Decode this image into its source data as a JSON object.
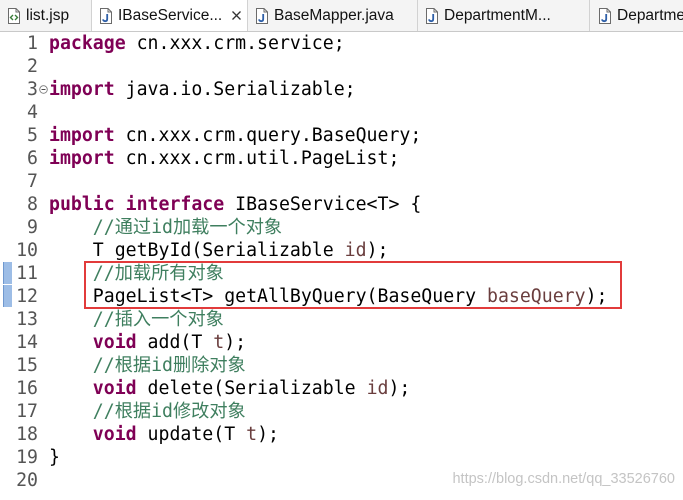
{
  "tabs": [
    {
      "label": "list.jsp",
      "icon": "jsp-file-icon"
    },
    {
      "label": "IBaseService...",
      "icon": "java-file-icon",
      "close_icon": "close-icon"
    },
    {
      "label": "BaseMapper.java",
      "icon": "java-file-icon"
    },
    {
      "label": "DepartmentM...",
      "icon": "java-file-icon"
    },
    {
      "label": "Departme",
      "icon": "java-file-icon"
    }
  ],
  "active_tab": 1,
  "editor": {
    "colors": {
      "keyword": "#7f0055",
      "comment": "#3f7f5f",
      "parameter": "#6a3e3e",
      "text": "#000000",
      "line_number": "#555555",
      "change_marker": "#9dbde6"
    },
    "fold_icon": "fold-collapse-icon",
    "change_markers": [
      11,
      12
    ],
    "highlight_box": {
      "color": "#e23b3b",
      "from_line": 11,
      "to_line": 12
    },
    "lines": [
      {
        "n": "1",
        "tokens": [
          "package",
          " cn.xxx.crm.service;"
        ]
      },
      {
        "n": "2",
        "tokens": []
      },
      {
        "n": "3",
        "tokens": [
          "import",
          " java.io.Serializable;"
        ]
      },
      {
        "n": "4",
        "tokens": []
      },
      {
        "n": "5",
        "tokens": [
          "import",
          " cn.xxx.crm.query.BaseQuery;"
        ]
      },
      {
        "n": "6",
        "tokens": [
          "import",
          " cn.xxx.crm.util.PageList;"
        ]
      },
      {
        "n": "7",
        "tokens": []
      },
      {
        "n": "8",
        "tokens": [
          "public",
          " interface",
          " IBaseService<T> {"
        ]
      },
      {
        "n": "9",
        "tokens": [
          "//通过id加载一个对象"
        ]
      },
      {
        "n": "10",
        "tokens": [
          "T getById(Serializable ",
          "id",
          ");"
        ]
      },
      {
        "n": "11",
        "tokens": [
          "//加载所有对象"
        ]
      },
      {
        "n": "12",
        "tokens": [
          "PageList<T> getAllByQuery(BaseQuery ",
          "baseQuery",
          ");"
        ]
      },
      {
        "n": "13",
        "tokens": [
          "//插入一个对象"
        ]
      },
      {
        "n": "14",
        "tokens": [
          "void",
          " add(T ",
          "t",
          ");"
        ]
      },
      {
        "n": "15",
        "tokens": [
          "//根据id删除对象"
        ]
      },
      {
        "n": "16",
        "tokens": [
          "void",
          " delete(Serializable ",
          "id",
          ");"
        ]
      },
      {
        "n": "17",
        "tokens": [
          "//根据id修改对象"
        ]
      },
      {
        "n": "18",
        "tokens": [
          "void",
          " update(T ",
          "t",
          ");"
        ]
      },
      {
        "n": "19",
        "tokens": [
          "}"
        ]
      },
      {
        "n": "20",
        "tokens": []
      }
    ]
  },
  "watermark": "https://blog.csdn.net/qq_33526760"
}
